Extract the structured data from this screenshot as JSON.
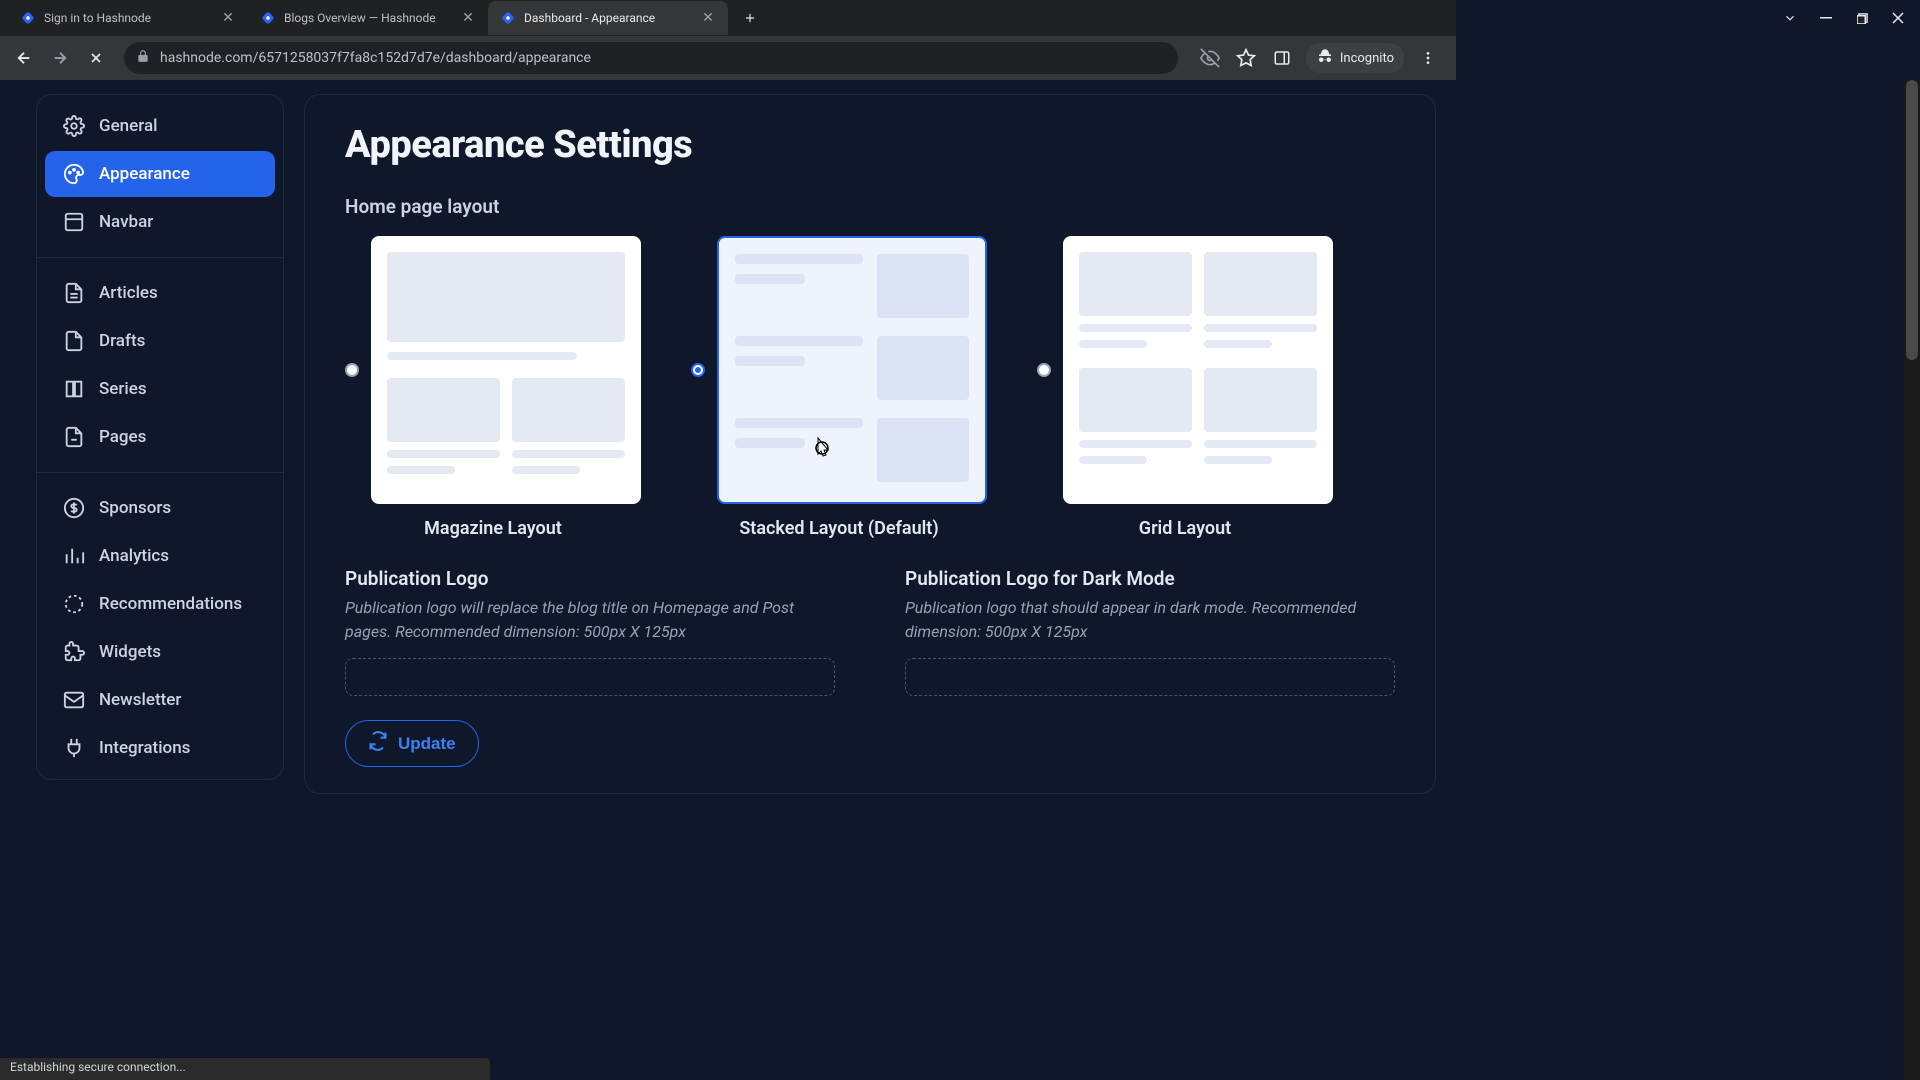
{
  "browser": {
    "tabs": [
      {
        "title": "Sign in to Hashnode",
        "active": false
      },
      {
        "title": "Blogs Overview — Hashnode",
        "active": false
      },
      {
        "title": "Dashboard - Appearance",
        "active": true
      }
    ],
    "url": "hashnode.com/6571258037f7fa8c152d7d7e/dashboard/appearance",
    "incognito_label": "Incognito",
    "status_text": "Establishing secure connection..."
  },
  "sidebar": {
    "groups": [
      [
        "General",
        "Appearance",
        "Navbar"
      ],
      [
        "Articles",
        "Drafts",
        "Series",
        "Pages"
      ],
      [
        "Sponsors",
        "Analytics",
        "Recommendations",
        "Widgets",
        "Newsletter",
        "Integrations"
      ]
    ],
    "active": "Appearance"
  },
  "page": {
    "title": "Appearance Settings",
    "layout_section_title": "Home page layout",
    "layouts": [
      {
        "label": "Magazine Layout",
        "selected": false
      },
      {
        "label": "Stacked Layout (Default)",
        "selected": true
      },
      {
        "label": "Grid Layout",
        "selected": false
      }
    ],
    "logo": {
      "light_title": "Publication Logo",
      "light_desc": "Publication logo will replace the blog title on Homepage and Post pages. Recommended dimension: 500px X 125px",
      "dark_title": "Publication Logo for Dark Mode",
      "dark_desc": "Publication logo that should appear in dark mode. Recommended dimension: 500px X 125px"
    },
    "update_label": "Update"
  }
}
